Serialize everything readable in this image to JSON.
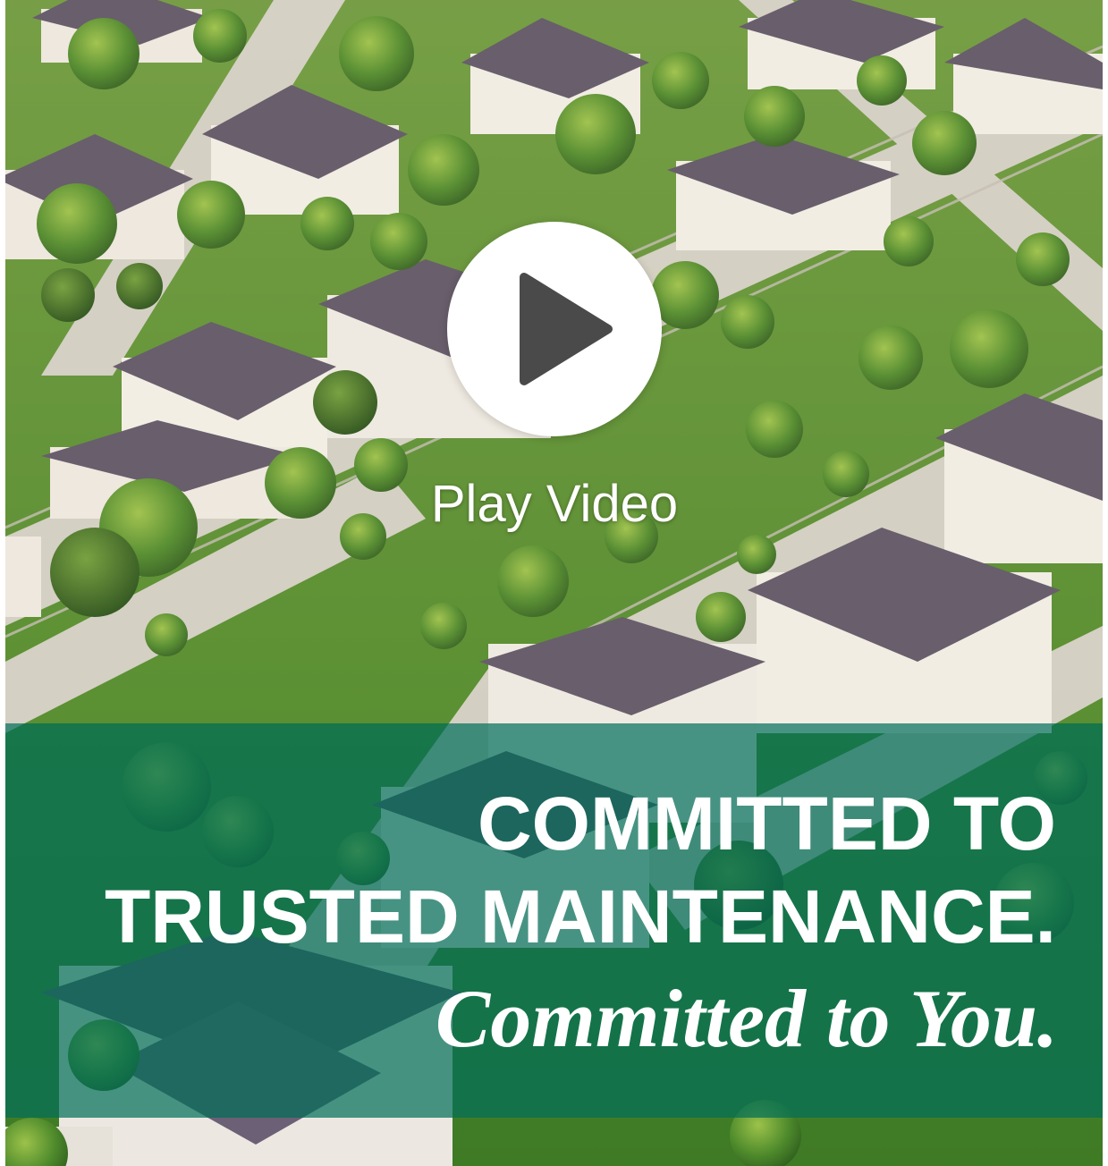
{
  "hero": {
    "image_description_icon": "neighborhood-aerial-photo",
    "play": {
      "icon": "play-icon",
      "label": "Play Video"
    }
  },
  "banner": {
    "headline_line1": "COMMITTED TO",
    "headline_line2": "TRUSTED MAINTENANCE.",
    "tagline": "Committed to You.",
    "overlay_color": "#006e58"
  },
  "colors": {
    "text": "#ffffff",
    "play_circle": "#ffffff",
    "play_triangle": "#4a4a4a",
    "grass": "#4f8a2a",
    "roof": "#5e5468",
    "street": "#d9d4cf"
  }
}
